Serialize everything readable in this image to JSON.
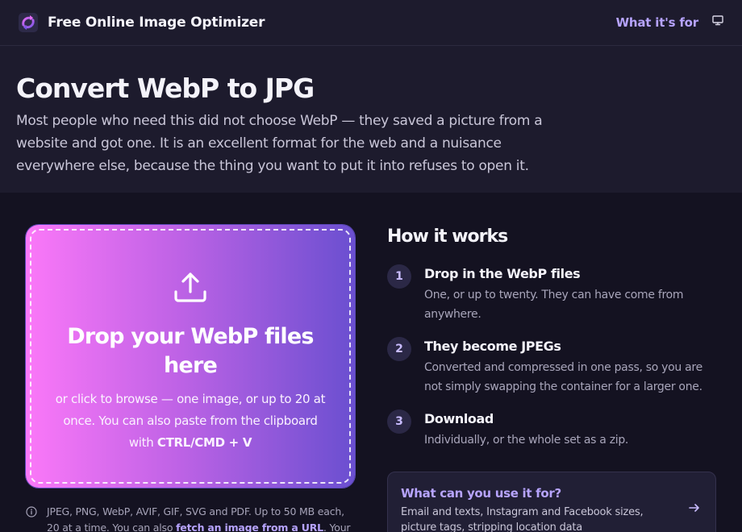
{
  "header": {
    "brand": "Free Online Image Optimizer",
    "nav_link": "What it's for",
    "logo_icon": "refresh-arrows-icon",
    "theme_icon": "monitor-icon"
  },
  "hero": {
    "title": "Convert WebP to JPG",
    "description": "Most people who need this did not choose WebP — they saved a picture from a website and got one. It is an excellent format for the web and a nuisance everywhere else, because the thing you want to put it into refuses to open it."
  },
  "dropzone": {
    "icon": "upload-icon",
    "title": "Drop your WebP files here",
    "subtitle_pre": "or click to browse — one image, or up to 20 at once. You can also paste from the clipboard with ",
    "shortcut": "CTRL/CMD + V"
  },
  "note": {
    "icon": "info-icon",
    "text_pre": "JPEG, PNG, WebP, AVIF, GIF, SVG and PDF. Up to 50 MB each, 20 at a time. You can also ",
    "link": "fetch an image from a URL",
    "text_post": ". Your"
  },
  "how_it_works": {
    "heading": "How it works",
    "steps": [
      {
        "number": "1",
        "title": "Drop in the WebP files",
        "description": "One, or up to twenty. They can have come from anywhere."
      },
      {
        "number": "2",
        "title": "They become JPEGs",
        "description": "Converted and compressed in one pass, so you are not simply swapping the container for a larger one."
      },
      {
        "number": "3",
        "title": "Download",
        "description": "Individually, or the whole set as a zip."
      }
    ]
  },
  "use_card": {
    "title": "What can you use it for?",
    "description": "Email and texts, Instagram and Facebook sizes, picture tags, stripping location data",
    "icon": "arrow-right-icon"
  },
  "colors": {
    "accent": "#b7a4ff",
    "gradient_start": "#fb78f8",
    "gradient_end": "#6a4fd0",
    "background": "#141221",
    "panel": "#1d1b2d"
  }
}
